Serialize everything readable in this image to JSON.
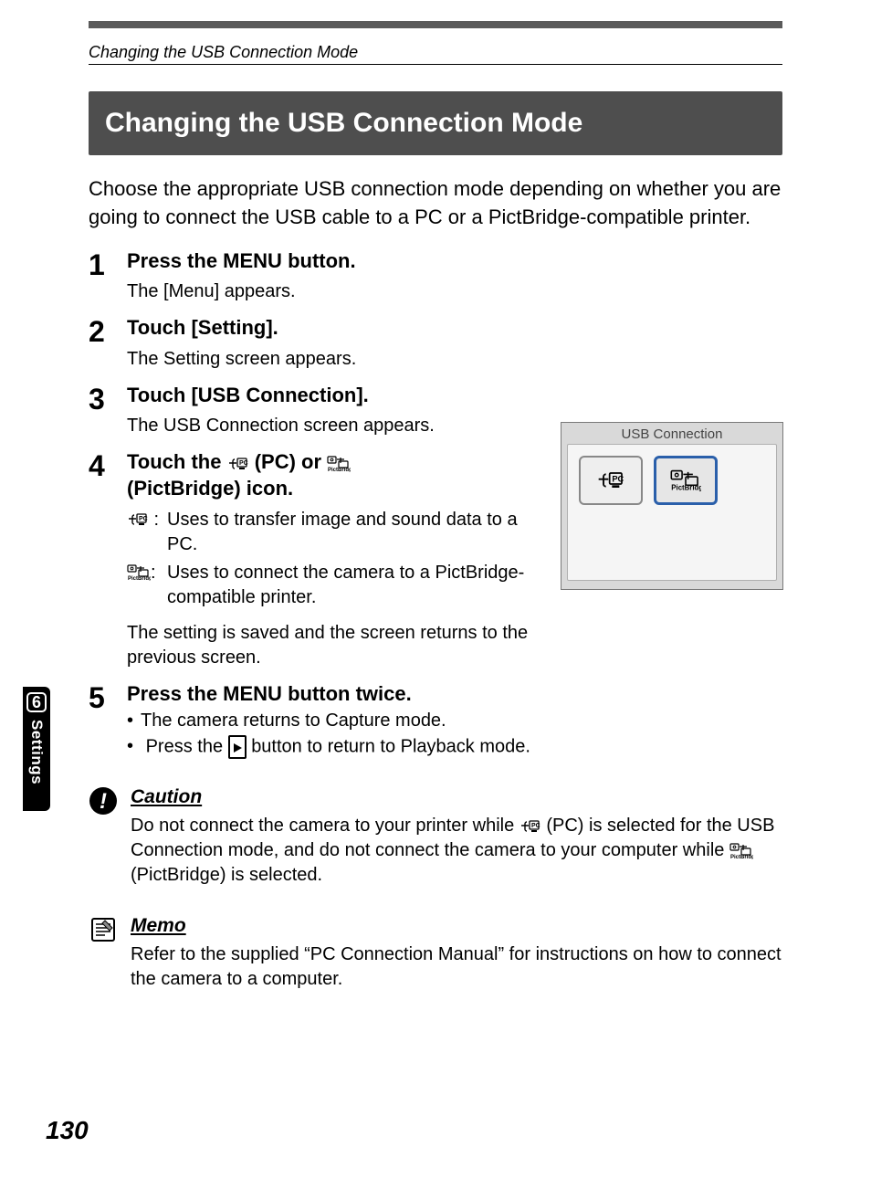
{
  "runningHeader": "Changing the USB Connection Mode",
  "title": "Changing the USB Connection Mode",
  "intro": "Choose the appropriate USB connection mode depending on whether you are going to connect the USB cable to a PC or a PictBridge-compatible printer.",
  "steps": [
    {
      "num": "1",
      "title_pre": "Press the ",
      "title_bold": "MENU",
      "title_post": " button.",
      "desc": "The [Menu] appears."
    },
    {
      "num": "2",
      "title": "Touch [Setting].",
      "desc": "The Setting screen appears."
    },
    {
      "num": "3",
      "title": "Touch [USB Connection].",
      "desc": "The USB Connection screen appears."
    },
    {
      "num": "4",
      "title_a": "Touch the ",
      "title_b": " (PC) or ",
      "title_c": " (PictBridge) icon.",
      "defs": [
        {
          "icon": "pc",
          "text_a": "Uses to transfer image and sound data to a PC."
        },
        {
          "icon": "pb",
          "text_a": "Uses to connect the camera to a PictBridge-compatible printer."
        }
      ],
      "after": "The setting is saved and the screen returns to the previous screen."
    },
    {
      "num": "5",
      "title_pre": "Press the ",
      "title_bold": "MENU",
      "title_post": " button twice.",
      "bullets_a": "The camera returns to Capture mode.",
      "bullets_b_pre": "Press the ",
      "bullets_b_post": " button to return to Playback mode."
    }
  ],
  "caution": {
    "title": "Caution",
    "text_a": "Do not connect the camera to your printer while ",
    "text_b": " (PC) is selected for the USB Connection mode, and do not connect the camera to your computer while ",
    "text_c": " (PictBridge) is selected."
  },
  "memo": {
    "title": "Memo",
    "text": "Refer to the supplied “PC Connection Manual” for instructions on how to connect the camera to a computer."
  },
  "screenshot": {
    "title": "USB Connection",
    "pcLabel": "PC",
    "pictBridgeLabel": "PictBridge"
  },
  "sideTab": {
    "number": "6",
    "label": "Settings"
  },
  "pageNumber": "130"
}
